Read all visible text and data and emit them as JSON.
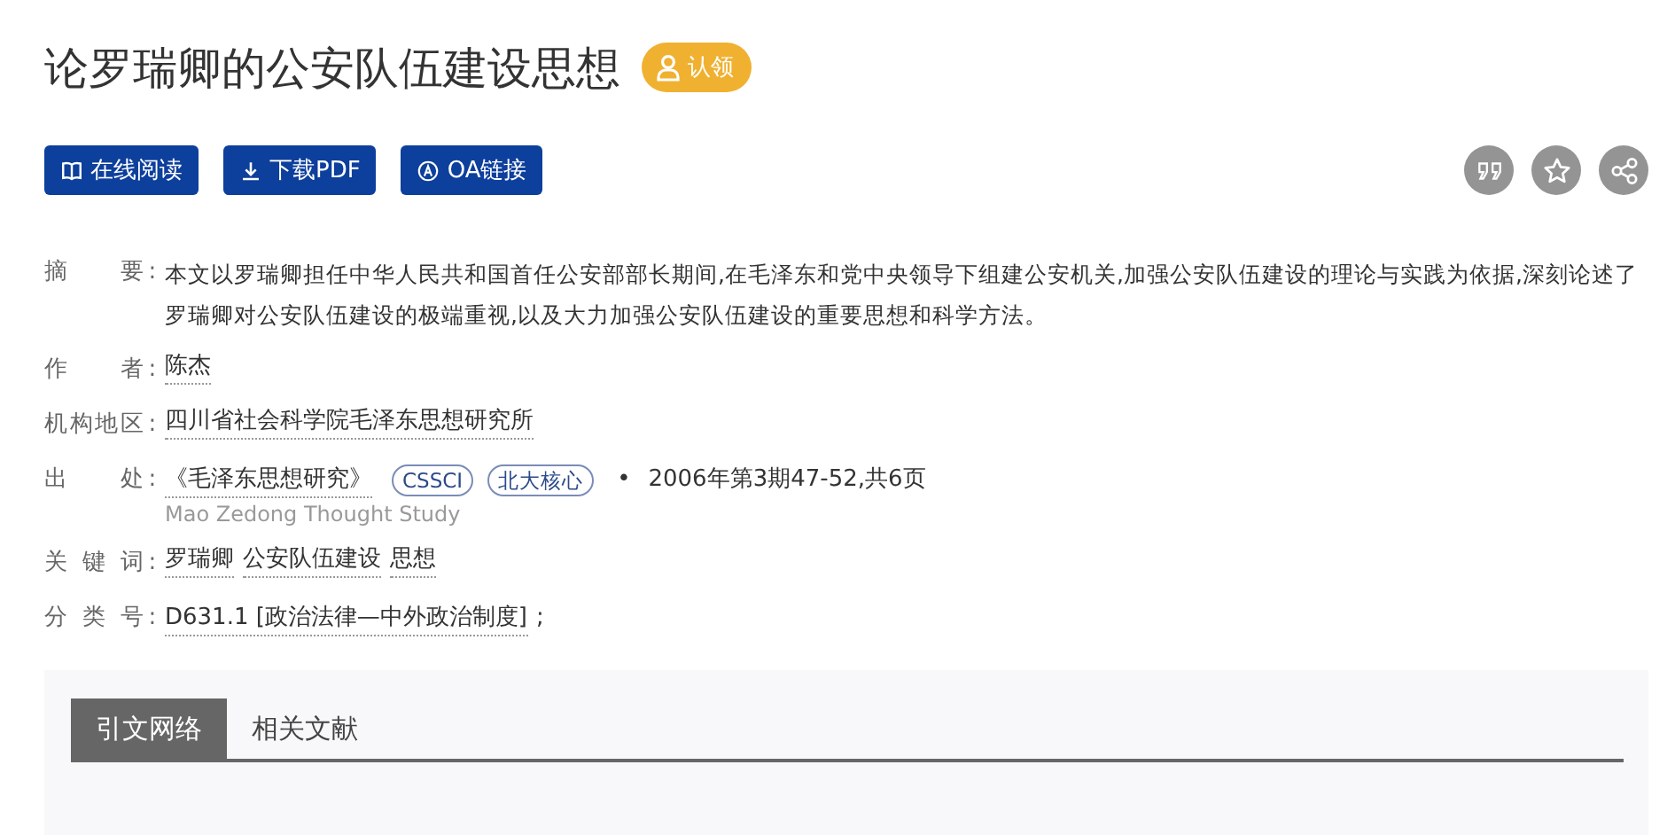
{
  "title": "论罗瑞卿的公安队伍建设思想",
  "claim_button": "认领",
  "actions": [
    {
      "kind": "read",
      "label": "在线阅读"
    },
    {
      "kind": "download",
      "label": "下载PDF"
    },
    {
      "kind": "oa",
      "label": "OA链接"
    }
  ],
  "tools": [
    {
      "kind": "cite"
    },
    {
      "kind": "favorite"
    },
    {
      "kind": "share"
    }
  ],
  "fields": [
    {
      "kind": "text",
      "label": "摘要",
      "colon": ":",
      "text": "本文以罗瑞卿担任中华人民共和国首任公安部部长期间,在毛泽东和党中央领导下组建公安机关,加强公安队伍建设的理论与实践为依据,深刻论述了罗瑞卿对公安队伍建设的极端重视,以及大力加强公安队伍建设的重要思想和科学方法。"
    },
    {
      "kind": "links",
      "label": "作者",
      "colon": ":",
      "links": [
        "陈杰"
      ]
    },
    {
      "kind": "links",
      "label": "机构地区",
      "colon": ":",
      "links": [
        "四川省社会科学院毛泽东思想研究所"
      ]
    },
    {
      "kind": "source",
      "label": "出处",
      "colon": ":",
      "journal": "《毛泽东思想研究》",
      "badges": [
        "CSSCI",
        "北大核心"
      ],
      "separator": "•",
      "detail": "2006年第3期47-52,共6页",
      "subtitle": "Mao Zedong Thought Study"
    },
    {
      "kind": "links",
      "label": "关键词",
      "colon": ":",
      "links": [
        "罗瑞卿",
        "公安队伍建设",
        "思想"
      ]
    },
    {
      "kind": "links",
      "label": "分类号",
      "colon": ":",
      "links": [
        "D631.1 [政治法律—中外政治制度]"
      ],
      "suffix": ";"
    }
  ],
  "tabs": [
    {
      "label": "引文网络",
      "selected": true
    },
    {
      "label": "相关文献",
      "selected": false
    }
  ]
}
